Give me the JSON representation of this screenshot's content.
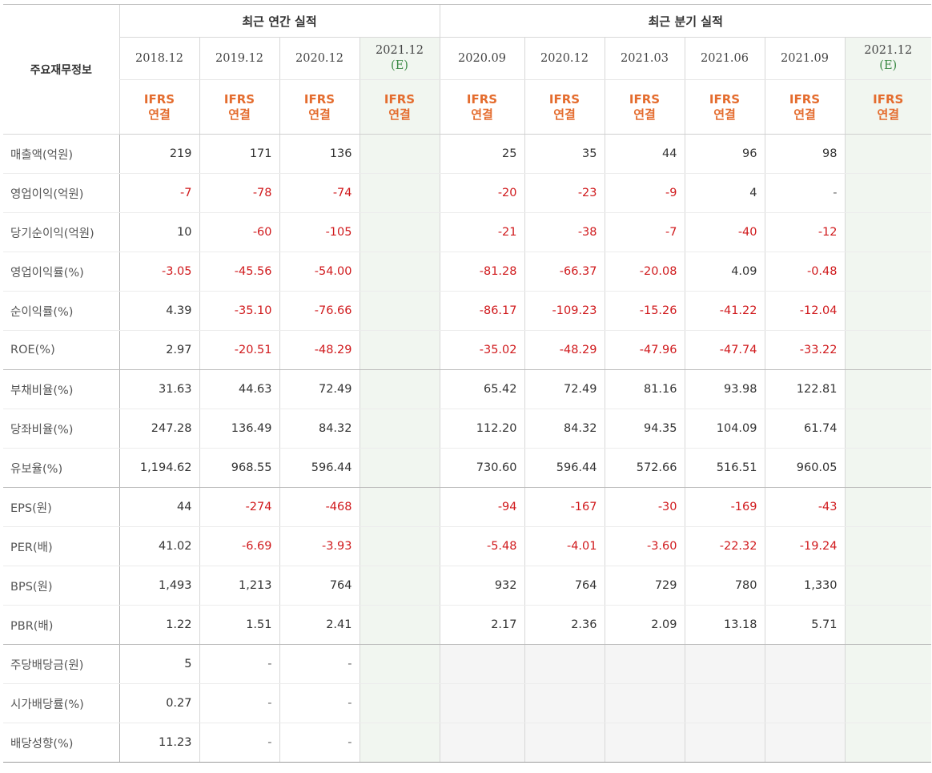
{
  "header": {
    "label": "주요재무정보",
    "annual": "최근 연간 실적",
    "quarterly": "최근 분기 실적",
    "periods": [
      {
        "p": "2018.12",
        "e": ""
      },
      {
        "p": "2019.12",
        "e": ""
      },
      {
        "p": "2020.12",
        "e": ""
      },
      {
        "p": "2021.12",
        "e": "(E)"
      },
      {
        "p": "2020.09",
        "e": ""
      },
      {
        "p": "2020.12",
        "e": ""
      },
      {
        "p": "2021.03",
        "e": ""
      },
      {
        "p": "2021.06",
        "e": ""
      },
      {
        "p": "2021.09",
        "e": ""
      },
      {
        "p": "2021.12",
        "e": "(E)"
      }
    ],
    "std_top": "IFRS",
    "std_bottom": "연결"
  },
  "rows": [
    {
      "label": "매출액(억원)",
      "values": [
        "219",
        "171",
        "136",
        "",
        "25",
        "35",
        "44",
        "96",
        "98",
        ""
      ]
    },
    {
      "label": "영업이익(억원)",
      "values": [
        "-7",
        "-78",
        "-74",
        "",
        "-20",
        "-23",
        "-9",
        "4",
        "-",
        ""
      ]
    },
    {
      "label": "당기순이익(억원)",
      "values": [
        "10",
        "-60",
        "-105",
        "",
        "-21",
        "-38",
        "-7",
        "-40",
        "-12",
        ""
      ]
    },
    {
      "label": "영업이익률(%)",
      "values": [
        "-3.05",
        "-45.56",
        "-54.00",
        "",
        "-81.28",
        "-66.37",
        "-20.08",
        "4.09",
        "-0.48",
        ""
      ]
    },
    {
      "label": "순이익률(%)",
      "values": [
        "4.39",
        "-35.10",
        "-76.66",
        "",
        "-86.17",
        "-109.23",
        "-15.26",
        "-41.22",
        "-12.04",
        ""
      ]
    },
    {
      "label": "ROE(%)",
      "values": [
        "2.97",
        "-20.51",
        "-48.29",
        "",
        "-35.02",
        "-48.29",
        "-47.96",
        "-47.74",
        "-33.22",
        ""
      ]
    },
    {
      "label": "부채비율(%)",
      "values": [
        "31.63",
        "44.63",
        "72.49",
        "",
        "65.42",
        "72.49",
        "81.16",
        "93.98",
        "122.81",
        ""
      ]
    },
    {
      "label": "당좌비율(%)",
      "values": [
        "247.28",
        "136.49",
        "84.32",
        "",
        "112.20",
        "84.32",
        "94.35",
        "104.09",
        "61.74",
        ""
      ]
    },
    {
      "label": "유보율(%)",
      "values": [
        "1,194.62",
        "968.55",
        "596.44",
        "",
        "730.60",
        "596.44",
        "572.66",
        "516.51",
        "960.05",
        ""
      ]
    },
    {
      "label": "EPS(원)",
      "values": [
        "44",
        "-274",
        "-468",
        "",
        "-94",
        "-167",
        "-30",
        "-169",
        "-43",
        ""
      ]
    },
    {
      "label": "PER(배)",
      "values": [
        "41.02",
        "-6.69",
        "-3.93",
        "",
        "-5.48",
        "-4.01",
        "-3.60",
        "-22.32",
        "-19.24",
        ""
      ]
    },
    {
      "label": "BPS(원)",
      "values": [
        "1,493",
        "1,213",
        "764",
        "",
        "932",
        "764",
        "729",
        "780",
        "1,330",
        ""
      ]
    },
    {
      "label": "PBR(배)",
      "values": [
        "1.22",
        "1.51",
        "2.41",
        "",
        "2.17",
        "2.36",
        "2.09",
        "13.18",
        "5.71",
        ""
      ]
    },
    {
      "label": "주당배당금(원)",
      "values": [
        "5",
        "-",
        "-",
        "",
        "",
        "",
        "",
        "",
        "",
        ""
      ]
    },
    {
      "label": "시가배당률(%)",
      "values": [
        "0.27",
        "-",
        "-",
        "",
        "",
        "",
        "",
        "",
        "",
        ""
      ]
    },
    {
      "label": "배당성향(%)",
      "values": [
        "11.23",
        "-",
        "-",
        "",
        "",
        "",
        "",
        "",
        "",
        ""
      ]
    }
  ],
  "colors": {
    "negative": "#d0191c",
    "standard": "#e46c2e",
    "estimate": "#3c8a46"
  }
}
